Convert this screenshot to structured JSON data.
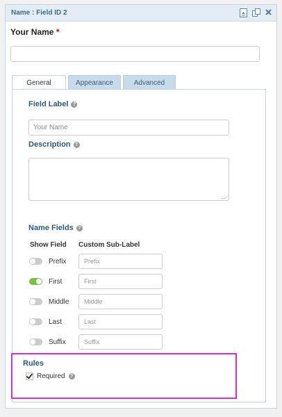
{
  "panel": {
    "title": "Name : Field ID 2"
  },
  "field": {
    "label": "Your Name",
    "required_marker": "*"
  },
  "tabs": [
    {
      "label": "General"
    },
    {
      "label": "Appearance"
    },
    {
      "label": "Advanced"
    }
  ],
  "general": {
    "field_label": {
      "label": "Field Label",
      "value": "Your Name"
    },
    "description": {
      "label": "Description",
      "value": ""
    },
    "name_fields": {
      "label": "Name Fields",
      "col_show": "Show Field",
      "col_sublabel": "Custom Sub-Label",
      "rows": [
        {
          "label": "Prefix",
          "enabled": false,
          "placeholder": "Prefix"
        },
        {
          "label": "First",
          "enabled": true,
          "placeholder": "First"
        },
        {
          "label": "Middle",
          "enabled": false,
          "placeholder": "Middle"
        },
        {
          "label": "Last",
          "enabled": false,
          "placeholder": "Last"
        },
        {
          "label": "Suffix",
          "enabled": false,
          "placeholder": "Suffix"
        }
      ]
    }
  },
  "rules": {
    "title": "Rules",
    "required_label": "Required",
    "required_checked": true
  },
  "icons": {
    "help": "help-icon",
    "collapse": "collapse-icon",
    "duplicate": "duplicate-icon",
    "delete": "close-icon"
  },
  "colors": {
    "accent": "#2d5878",
    "toggle_on": "#7ac143",
    "highlight": "#d12fd1"
  }
}
